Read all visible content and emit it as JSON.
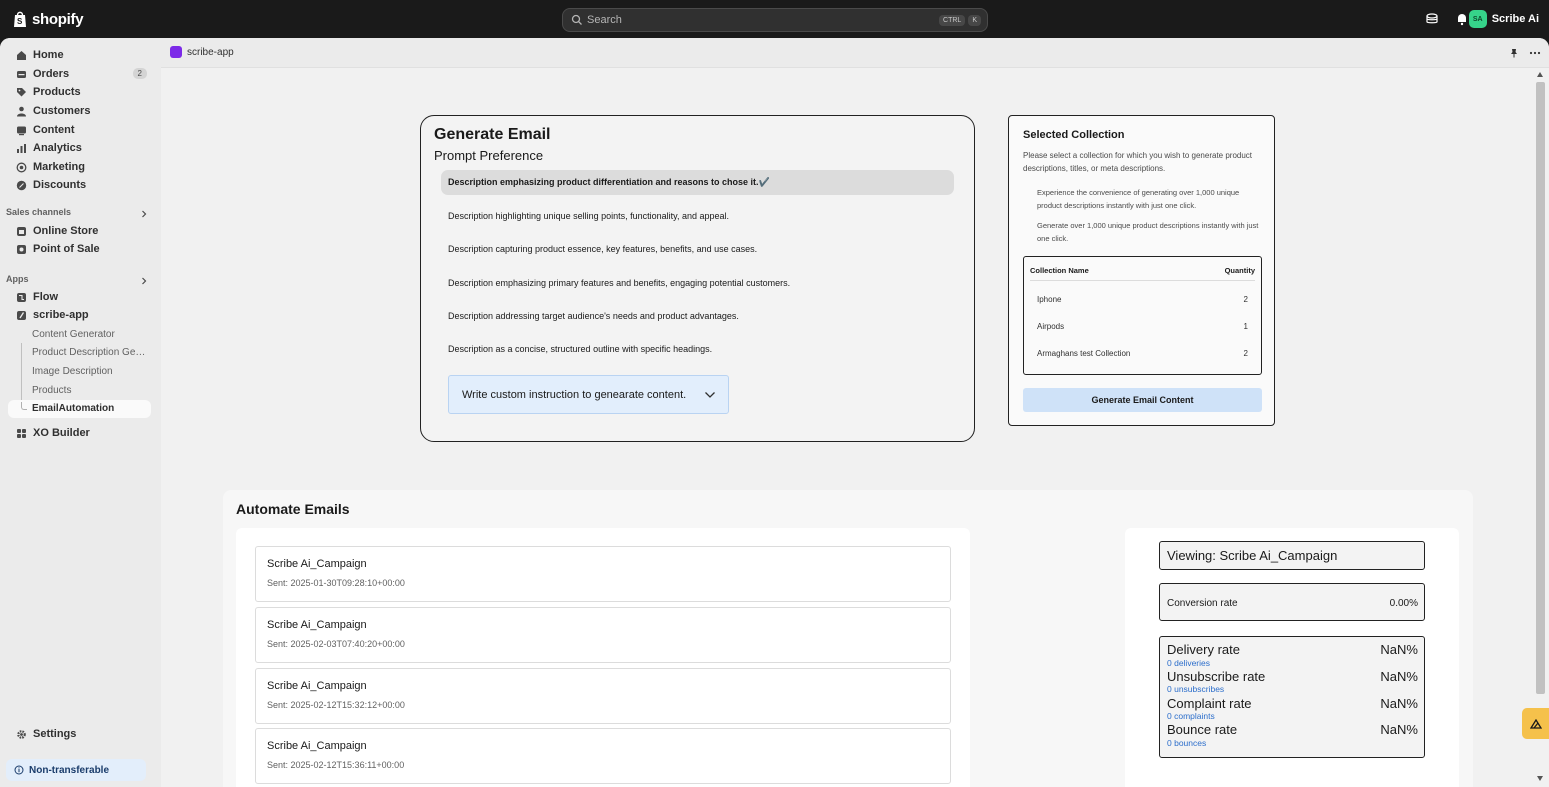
{
  "topbar": {
    "brand": "shopify",
    "search_placeholder": "Search",
    "shortcut_ctrl": "CTRL",
    "shortcut_key": "K",
    "user_initials": "SA",
    "user_name": "Scribe Ai"
  },
  "sidebar": {
    "items": [
      {
        "label": "Home",
        "icon": "home-icon"
      },
      {
        "label": "Orders",
        "icon": "orders-icon",
        "badge": "2"
      },
      {
        "label": "Products",
        "icon": "tag-icon"
      },
      {
        "label": "Customers",
        "icon": "person-icon"
      },
      {
        "label": "Content",
        "icon": "content-icon"
      },
      {
        "label": "Analytics",
        "icon": "chart-icon"
      },
      {
        "label": "Marketing",
        "icon": "target-icon"
      },
      {
        "label": "Discounts",
        "icon": "discount-icon"
      }
    ],
    "sales_channels_label": "Sales channels",
    "channels": [
      {
        "label": "Online Store",
        "icon": "store-icon"
      },
      {
        "label": "Point of Sale",
        "icon": "pos-icon"
      }
    ],
    "apps_label": "Apps",
    "apps": [
      {
        "label": "Flow",
        "icon": "flow-icon"
      },
      {
        "label": "scribe-app",
        "icon": "scribe-icon"
      }
    ],
    "sub_items": [
      "Content Generator",
      "Product Description Generator",
      "Image Description",
      "Products"
    ],
    "active_sub": "EmailAutomation",
    "xo_builder": "XO Builder",
    "settings": "Settings",
    "non_transferable": "Non-transferable"
  },
  "app_header": {
    "title": "scribe-app"
  },
  "generate": {
    "title": "Generate Email",
    "subtitle": "Prompt Preference",
    "options": [
      "Description emphasizing product differentiation and reasons to chose it.✔️",
      "Description highlighting unique selling points, functionality, and appeal.",
      "Description capturing product essence, key features, benefits, and use cases.",
      "Description emphasizing primary features and benefits, engaging potential customers.",
      "Description addressing target audience's needs and product advantages.",
      "Description as a concise, structured outline with specific headings."
    ],
    "selected_index": 0,
    "custom_instruction": "Write custom instruction to genearate content."
  },
  "collection": {
    "title": "Selected Collection",
    "description": "Please select a collection for which you wish to generate product descriptions, titles, or meta descriptions.",
    "note1": "Experience the convenience of generating over 1,000 unique product descriptions instantly with just one click.",
    "note2": "Generate over 1,000 unique product descriptions instantly with just one click.",
    "col_name_header": "Collection Name",
    "col_qty_header": "Quantity",
    "rows": [
      {
        "name": "Iphone",
        "qty": "2"
      },
      {
        "name": "Airpods",
        "qty": "1"
      },
      {
        "name": "Armaghans test Collection",
        "qty": "2"
      }
    ],
    "button": "Generate Email Content"
  },
  "automate": {
    "title": "Automate Emails",
    "campaigns": [
      {
        "name": "Scribe Ai_Campaign",
        "sent": "Sent: 2025-01-30T09:28:10+00:00"
      },
      {
        "name": "Scribe Ai_Campaign",
        "sent": "Sent: 2025-02-03T07:40:20+00:00"
      },
      {
        "name": "Scribe Ai_Campaign",
        "sent": "Sent: 2025-02-12T15:32:12+00:00"
      },
      {
        "name": "Scribe Ai_Campaign",
        "sent": "Sent: 2025-02-12T15:36:11+00:00"
      }
    ],
    "viewing": "Viewing: Scribe Ai_Campaign",
    "conversion_label": "Conversion rate",
    "conversion_value": "0.00%",
    "rates": [
      {
        "label": "Delivery rate",
        "value": "NaN%",
        "sub": "0 deliveries"
      },
      {
        "label": "Unsubscribe rate",
        "value": "NaN%",
        "sub": "0 unsubscribes"
      },
      {
        "label": "Complaint rate",
        "value": "NaN%",
        "sub": "0 complaints"
      },
      {
        "label": "Bounce rate",
        "value": "NaN%",
        "sub": "0 bounces"
      }
    ]
  }
}
